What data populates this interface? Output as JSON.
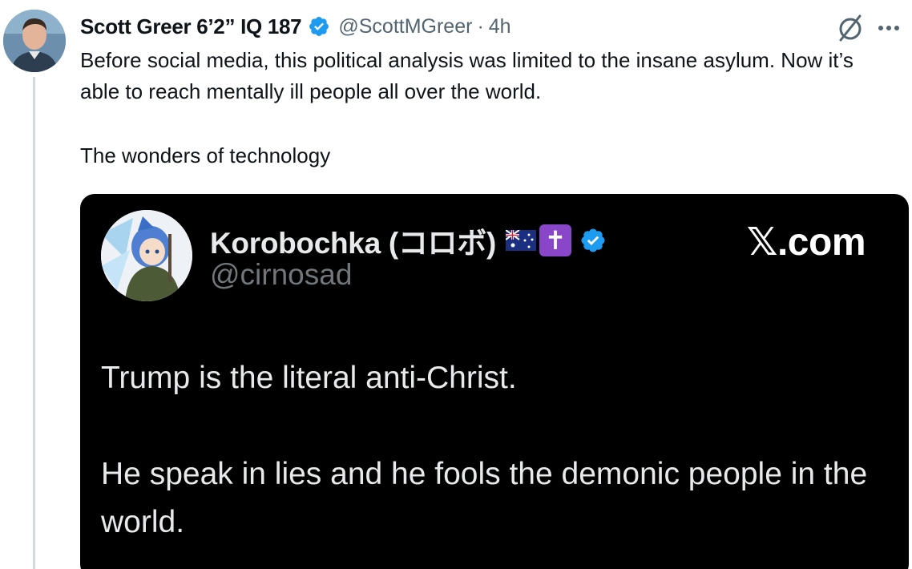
{
  "author": {
    "display_name": "Scott Greer 6’2” IQ 187",
    "handle": "@ScottMGreer",
    "separator": "·",
    "time": "4h",
    "avatar_icon": "person-avatar-icon",
    "verified_color": "#1d9bf0"
  },
  "tweet": {
    "paragraphs": [
      "Before social media, this political analysis was limited to the insane asylum. Now it’s able to reach mentally ill people all over the world.",
      "The wonders of technology"
    ]
  },
  "actions": {
    "mute_icon": "mute-icon",
    "more_icon": "more-icon"
  },
  "quoted": {
    "display_name": "Korobochka (コロボ)",
    "handle": "@cirnosad",
    "brand": ".com",
    "brand_letter": "𝕏",
    "emoji": {
      "flag": "australia-flag-icon",
      "cross": "✝"
    },
    "paragraphs": [
      "Trump is the literal anti-Christ.",
      "He speak in lies and he fools the demonic people in the world."
    ],
    "card_color": "#000000"
  }
}
